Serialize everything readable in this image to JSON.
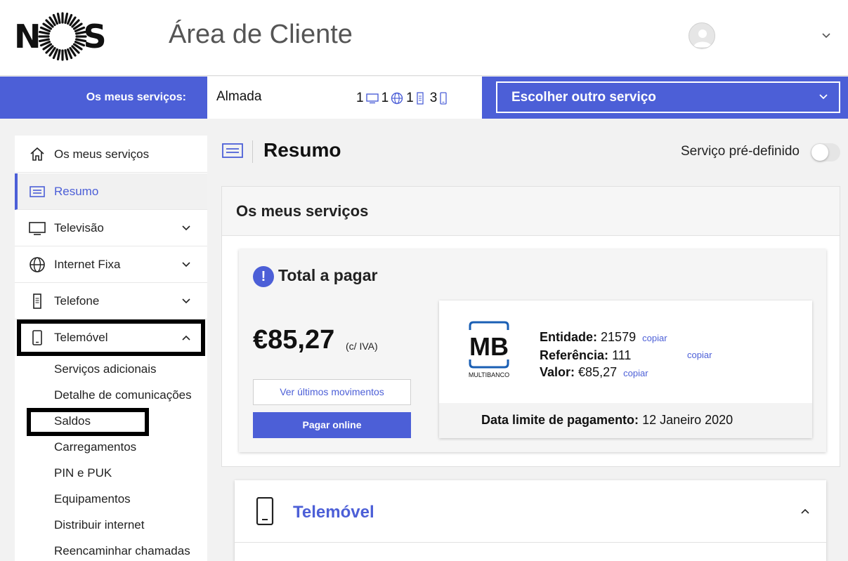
{
  "header": {
    "brand": "NOS",
    "title": "Área de Cliente",
    "icons": {
      "avatar": "user-avatar-icon",
      "menu": "chevron-down-icon"
    }
  },
  "service_bar": {
    "label": "Os meus serviços:",
    "current_service": "Almada",
    "counts": {
      "tv": "1",
      "internet": "1",
      "phone": "1",
      "mobile": "3"
    },
    "select_label": "Escolher outro serviço"
  },
  "sidebar": {
    "items": [
      {
        "label": "Os meus serviços",
        "icon": "home-icon"
      },
      {
        "label": "Resumo",
        "icon": "summary-icon",
        "active": true
      },
      {
        "label": "Televisão",
        "icon": "tv-icon"
      },
      {
        "label": "Internet Fixa",
        "icon": "globe-icon"
      },
      {
        "label": "Telefone",
        "icon": "landline-phone-icon"
      },
      {
        "label": "Telemóvel",
        "icon": "mobile-phone-icon",
        "expanded": true
      }
    ],
    "subitems": [
      "Serviços adicionais",
      "Detalhe de comunicações",
      "Saldos",
      "Carregamentos",
      "PIN e PUK",
      "Equipamentos",
      "Distribuir internet",
      "Reencaminhar chamadas"
    ]
  },
  "main": {
    "title": "Resumo",
    "toggle_label": "Serviço pré-definido",
    "toggle_on": false,
    "panel_title": "Os meus serviços",
    "payment": {
      "alert_symbol": "!",
      "title": "Total a pagar",
      "amount": "€85,27",
      "iva_note": "(c/ IVA)",
      "moves_button": "Ver últimos movimentos",
      "pay_button": "Pagar online",
      "mb": {
        "logo_text": "MB",
        "logo_caption": "MULTIBANCO",
        "entidade_label": "Entidade:",
        "entidade_value": "21579",
        "referencia_label": "Referência:",
        "referencia_value": "111",
        "valor_label": "Valor:",
        "valor_value": "€85,27",
        "copy_label": "copiar",
        "deadline_label": "Data limite de pagamento:",
        "deadline_value": "12 Janeiro 2020"
      }
    },
    "mobile_section": {
      "title": "Telemóvel"
    }
  },
  "colors": {
    "accent": "#4c5fd7",
    "highlight": "#000000"
  }
}
